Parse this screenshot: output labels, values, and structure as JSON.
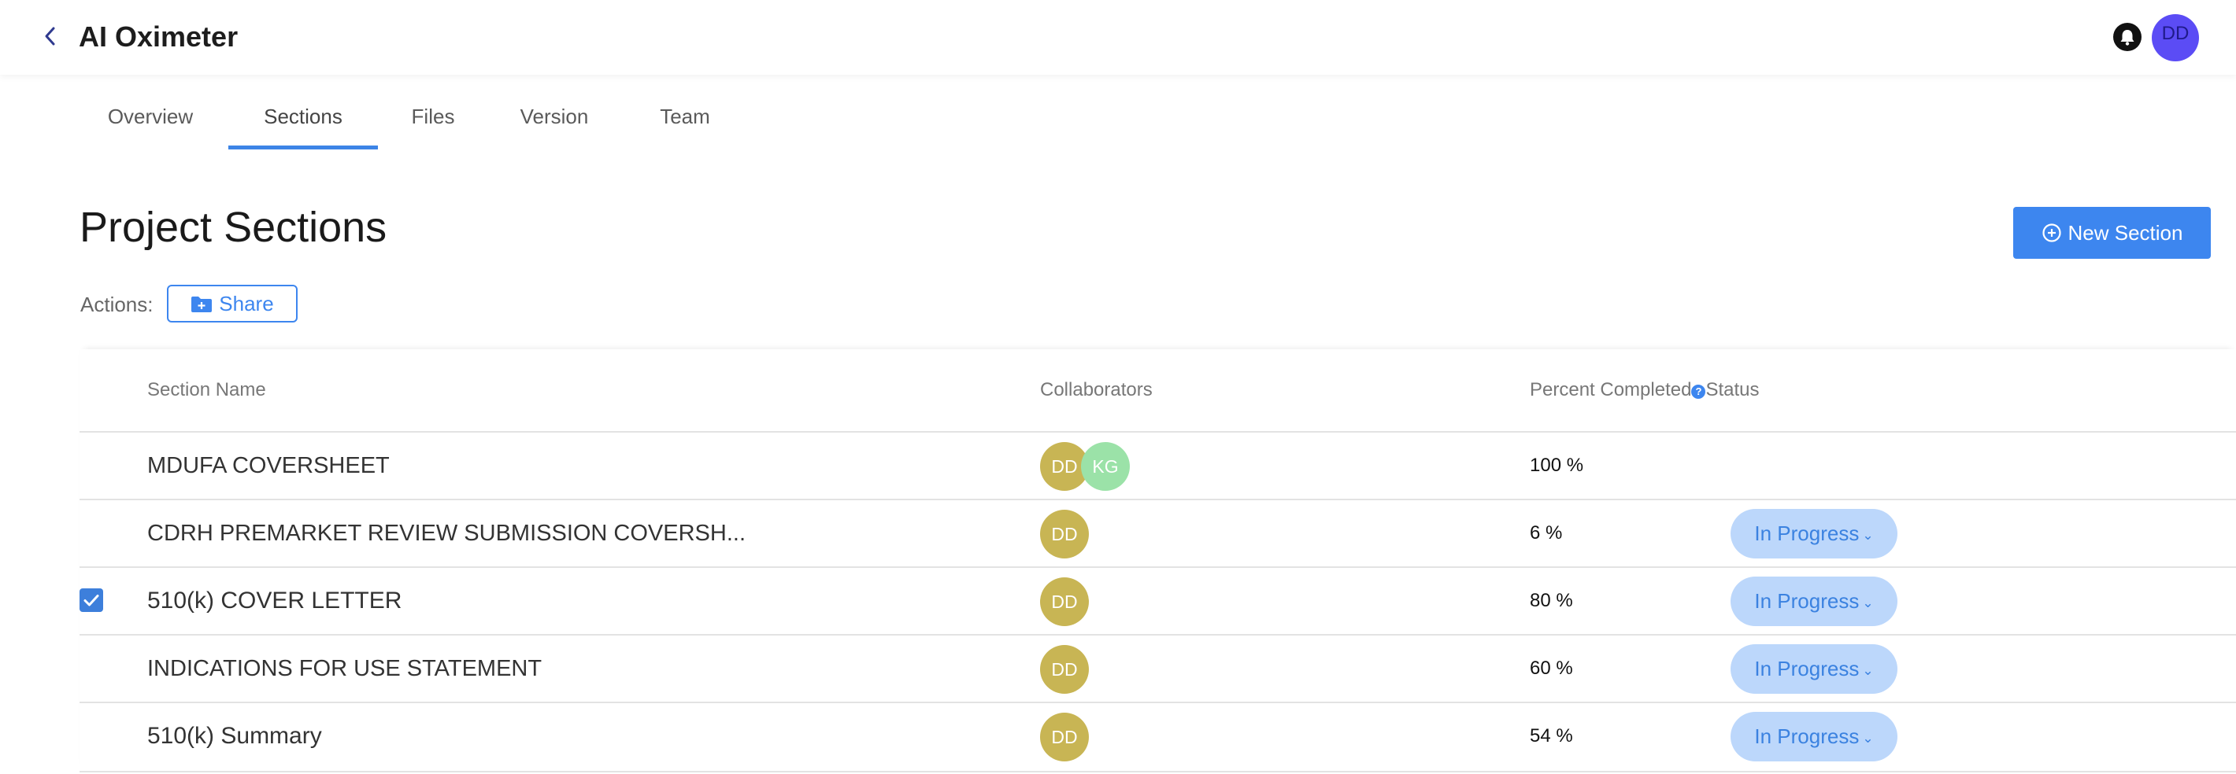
{
  "app": {
    "title": "AI Oximeter",
    "user_initials": "DD"
  },
  "tabs": [
    {
      "label": "Overview"
    },
    {
      "label": "Sections"
    },
    {
      "label": "Files"
    },
    {
      "label": "Version"
    },
    {
      "label": "Team"
    }
  ],
  "active_tab": "Sections",
  "page": {
    "title": "Project Sections",
    "new_section_label": "New Section"
  },
  "actions": {
    "label": "Actions:",
    "share_label": "Share"
  },
  "table": {
    "headers": {
      "section_name": "Section Name",
      "collaborators": "Collaborators",
      "percent_completed": "Percent Completed",
      "help": "?",
      "status": "Status"
    },
    "rows": [
      {
        "name": "MDUFA COVERSHEET",
        "collaborators": [
          "DD",
          "KG"
        ],
        "percent": "100 %",
        "status": "",
        "checked": false
      },
      {
        "name": "CDRH PREMARKET REVIEW SUBMISSION COVERSH...",
        "collaborators": [
          "DD"
        ],
        "percent": "6 %",
        "status": "In Progress",
        "checked": false
      },
      {
        "name": "510(k) COVER LETTER",
        "collaborators": [
          "DD"
        ],
        "percent": "80 %",
        "status": "In Progress",
        "checked": true
      },
      {
        "name": "INDICATIONS FOR USE STATEMENT",
        "collaborators": [
          "DD"
        ],
        "percent": "60 %",
        "status": "In Progress",
        "checked": false
      },
      {
        "name": "510(k) Summary",
        "collaborators": [
          "DD"
        ],
        "percent": "54 %",
        "status": "In Progress",
        "checked": false
      }
    ]
  },
  "colors": {
    "accent": "#3d86ef",
    "avatar_user": "#5b4cf5",
    "collaborator_dd": "#c8b554",
    "collaborator_kg": "#9be2a8",
    "status_pill": "#bcd7fb"
  }
}
